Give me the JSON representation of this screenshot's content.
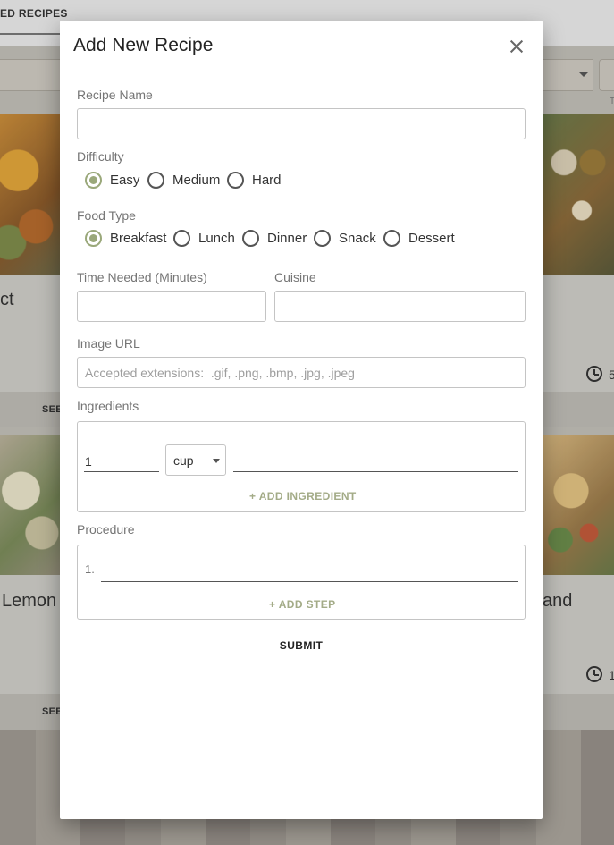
{
  "background": {
    "tab_label": "ED RECIPES",
    "cards": [
      {
        "title": "ct",
        "see_label": "SEE",
        "time_label": ""
      },
      {
        "title": "",
        "see_label": "",
        "time_label": "5"
      },
      {
        "title": "Lemon",
        "see_label": "SEE",
        "time_label": ""
      },
      {
        "title": "and",
        "see_label": "",
        "time_label": "1"
      }
    ],
    "filter_hint": "T"
  },
  "modal": {
    "title": "Add New Recipe",
    "recipe_name": {
      "label": "Recipe Name",
      "value": ""
    },
    "difficulty": {
      "label": "Difficulty",
      "options": [
        "Easy",
        "Medium",
        "Hard"
      ],
      "selected": "Easy"
    },
    "food_type": {
      "label": "Food Type",
      "options": [
        "Breakfast",
        "Lunch",
        "Dinner",
        "Snack",
        "Dessert"
      ],
      "selected": "Breakfast"
    },
    "time_needed": {
      "label": "Time Needed (Minutes)",
      "value": ""
    },
    "cuisine": {
      "label": "Cuisine",
      "value": ""
    },
    "image_url": {
      "label": "Image URL",
      "placeholder": "Accepted extensions:  .gif, .png, .bmp, .jpg, .jpeg",
      "value": ""
    },
    "ingredients": {
      "label": "Ingredients",
      "rows": [
        {
          "quantity": "1",
          "unit": "cup",
          "name": ""
        }
      ],
      "add_label": "+ ADD INGREDIENT"
    },
    "procedure": {
      "label": "Procedure",
      "steps": [
        {
          "number": "1.",
          "text": ""
        }
      ],
      "add_label": "+ ADD STEP"
    },
    "submit_label": "SUBMIT"
  },
  "colors": {
    "accent": "#9aa87a",
    "accent_text": "#a3ab87",
    "border": "#c4c4c4",
    "label": "#757575"
  }
}
